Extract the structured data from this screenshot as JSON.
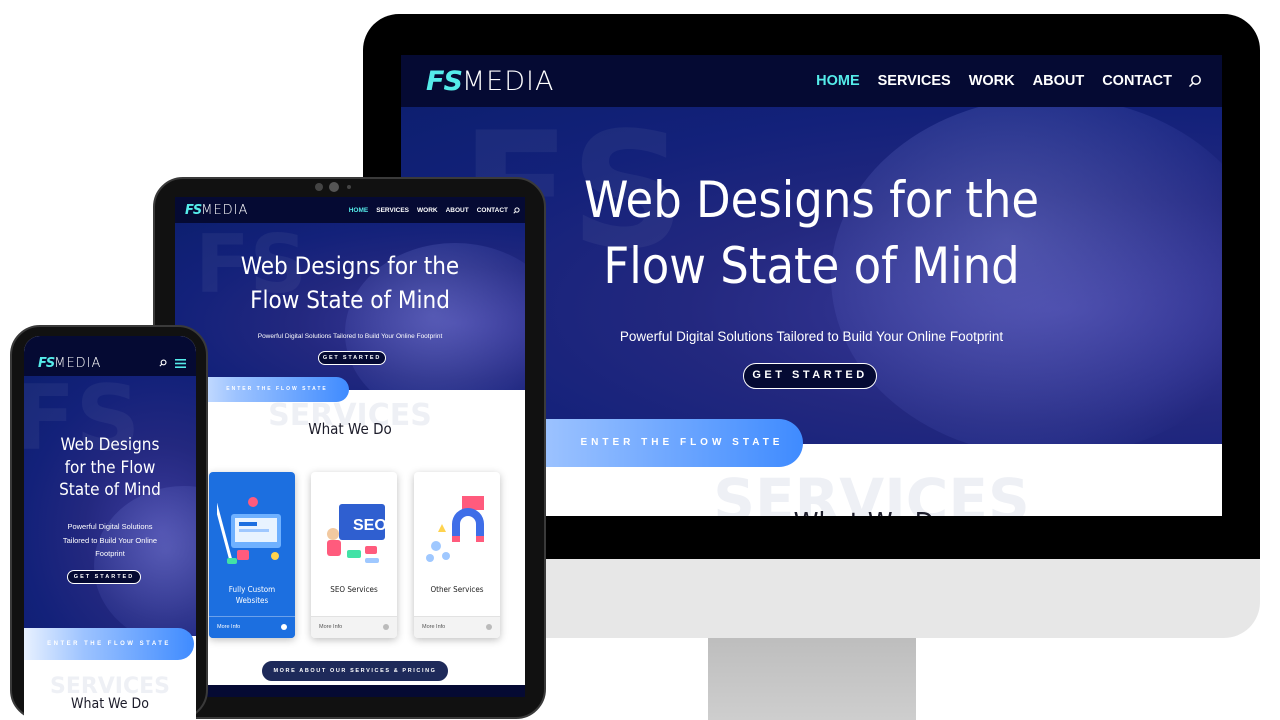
{
  "colors": {
    "nav_bg": "#050a33",
    "accent": "#55ecea",
    "hero_blue": "#13217a",
    "flow_blue": "#3f8bff",
    "card_blue": "#1c6fe0"
  },
  "site": {
    "logo_mark": "FS",
    "logo_word": "MEDIA",
    "nav": [
      "HOME",
      "SERVICES",
      "WORK",
      "ABOUT",
      "CONTACT"
    ],
    "active_nav": "HOME",
    "search_icon": "search-icon",
    "hero_title_line1": "Web Designs for the",
    "hero_title_line2": "Flow State of Mind",
    "hero_subtitle": "Powerful Digital Solutions Tailored to Build Your Online Footprint",
    "cta_label": "GET STARTED",
    "flow_label": "ENTER THE FLOW STATE",
    "services_ghost": "SERVICES",
    "section_title": "What We Do",
    "services_button": "MORE ABOUT OUR SERVICES & PRICING"
  },
  "desktop": {
    "section_title_partial": "What We Do"
  },
  "tablet": {
    "cards": [
      {
        "title_line1": "Fully Custom",
        "title_line2": "Websites",
        "more": "More Info"
      },
      {
        "title_line1": "SEO Services",
        "title_line2": "",
        "more": "More Info"
      },
      {
        "title_line1": "Other Services",
        "title_line2": "",
        "more": "More Info"
      }
    ]
  },
  "phone": {
    "hero_title_line1": "Web Designs",
    "hero_title_line2": "for the Flow",
    "hero_title_line3": "State of Mind",
    "hero_sub_line1": "Powerful Digital Solutions",
    "hero_sub_line2": "Tailored to Build Your Online",
    "hero_sub_line3": "Footprint",
    "menu_icon": "hamburger-icon"
  }
}
